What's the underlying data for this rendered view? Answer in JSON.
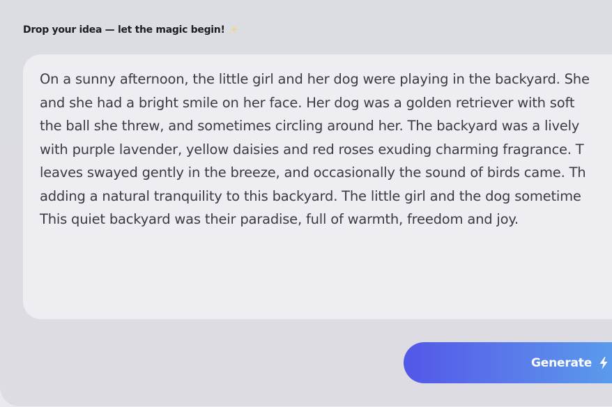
{
  "prompt": {
    "label": "Drop your idea — let the magic begin!",
    "label_icon": "sparkle-icon",
    "text_lines": [
      "On a sunny afternoon, the little girl and her dog were playing in the backyard. She",
      "and she had a bright smile on her face. Her dog was a golden retriever with soft",
      "the ball she threw, and sometimes circling around her. The backyard was a lively",
      "with purple lavender, yellow daisies and red roses exuding charming fragrance. T",
      "leaves swayed gently in the breeze, and occasionally the sound of birds came. Th",
      "adding a natural tranquility to this backyard. The little girl and the dog sometime",
      "This quiet backyard was their paradise, full of warmth, freedom and joy."
    ]
  },
  "actions": {
    "generate_label": "Generate",
    "generate_icon": "bolt-icon"
  },
  "colors": {
    "button_gradient_start": "#5257e8",
    "button_gradient_end": "#5aa4ec",
    "sparkle": "#f3d27a"
  }
}
